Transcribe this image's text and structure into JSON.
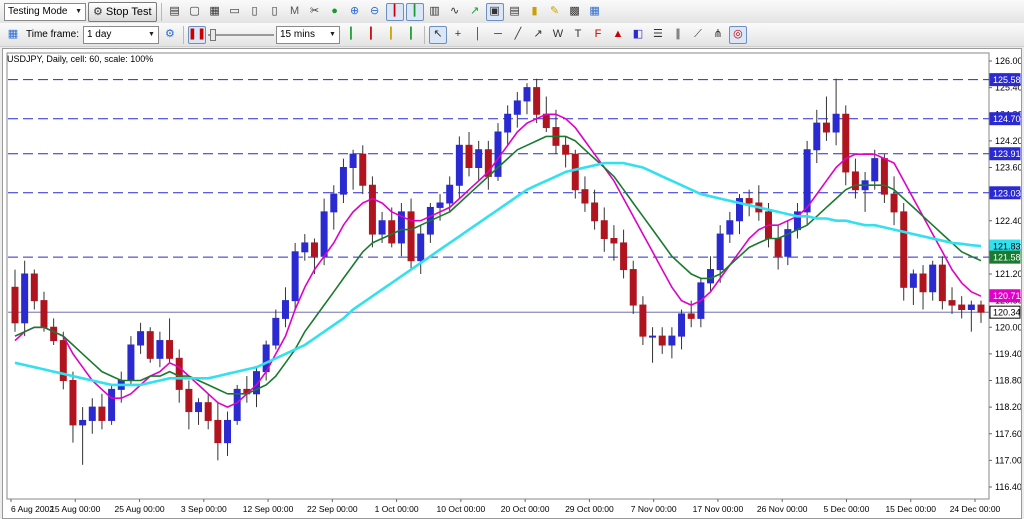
{
  "toolbar": {
    "mode_select": "Testing Mode",
    "stop_test_label": "Stop Test",
    "timeframe_label": "Time frame:",
    "timeframe_value": "1 day",
    "speed_value": "15 mins"
  },
  "icons_row1": [
    "bar-chart-icon",
    "window-icon",
    "tile-icon",
    "folder-icon",
    "new-doc-icon",
    "doc-icon",
    "document-m-icon",
    "scissors-icon",
    "record-icon",
    "zoom-in-icon",
    "zoom-out-icon",
    "candles-icon",
    "bars-icon",
    "layers-icon",
    "line-chart-icon",
    "chart-up-icon",
    "chart-box-icon",
    "template-icon",
    "book-icon",
    "brush-icon",
    "screenshot-icon",
    "calendar-icon"
  ],
  "icons_row2": [
    "cursor-icon",
    "crosshair-icon",
    "vertical-line-icon",
    "horizontal-line-icon",
    "trendline-icon",
    "ray-icon",
    "wave-w-icon",
    "text-t-icon",
    "fibo-icon",
    "arrow-icon",
    "color-icon",
    "horizontal-lines-icon",
    "channel-icon",
    "fan-icon",
    "pitchfork-icon",
    "magnet-icon"
  ],
  "chart_info": "USDJPY, Daily, cell: 60, scale: 100%",
  "colors": {
    "bull": "#2a2ad0",
    "bear": "#b0141e",
    "ma_fast": "#e000c8",
    "ma_mid": "#1a7a2e",
    "ma_slow": "#33e0ee",
    "level_line": "#2a2ad0"
  },
  "chart_data": {
    "type": "candlestick",
    "title": "USDJPY, Daily",
    "ylim": [
      116.4,
      126.0
    ],
    "y_ticks": [
      "126.00",
      "125.40",
      "124.80",
      "124.20",
      "123.60",
      "123.00",
      "122.40",
      "121.80",
      "121.20",
      "120.60",
      "120.00",
      "119.40",
      "118.80",
      "118.20",
      "117.60",
      "117.00",
      "116.40"
    ],
    "x_ticks": [
      "6 Aug 2002",
      "15 Aug 00:00",
      "25 Aug 00:00",
      "3 Sep 00:00",
      "12 Sep 00:00",
      "22 Sep 00:00",
      "1 Oct 00:00",
      "10 Oct 00:00",
      "20 Oct 00:00",
      "29 Oct 00:00",
      "7 Nov 00:00",
      "17 Nov 00:00",
      "26 Nov 00:00",
      "5 Dec 00:00",
      "15 Dec 00:00",
      "24 Dec 00:00"
    ],
    "levels": [
      {
        "value": 125.58,
        "label": "125.58"
      },
      {
        "value": 124.7,
        "label": "124.70"
      },
      {
        "value": 123.91,
        "label": "123.91"
      },
      {
        "value": 123.03,
        "label": "123.03"
      },
      {
        "value": 121.58,
        "label": "121.58"
      }
    ],
    "price_labels": [
      {
        "value": 121.83,
        "label": "121.83"
      },
      {
        "value": 121.58,
        "label": "121.58"
      },
      {
        "value": 120.71,
        "label": "120.71"
      },
      {
        "value": 120.34,
        "label": "120.34"
      }
    ],
    "current_price": 120.34,
    "candles": [
      [
        120.9,
        121.3,
        119.9,
        120.1
      ],
      [
        120.1,
        121.5,
        119.8,
        121.2
      ],
      [
        121.2,
        121.3,
        120.4,
        120.6
      ],
      [
        120.6,
        120.8,
        119.9,
        120.0
      ],
      [
        120.0,
        120.2,
        119.6,
        119.7
      ],
      [
        119.7,
        119.9,
        118.6,
        118.8
      ],
      [
        118.8,
        119.0,
        117.4,
        117.8
      ],
      [
        117.8,
        118.2,
        116.9,
        117.9
      ],
      [
        117.9,
        118.4,
        117.6,
        118.2
      ],
      [
        118.2,
        118.5,
        117.7,
        117.9
      ],
      [
        117.9,
        118.7,
        117.8,
        118.6
      ],
      [
        118.6,
        119.0,
        118.3,
        118.8
      ],
      [
        118.8,
        119.8,
        118.7,
        119.6
      ],
      [
        119.6,
        120.1,
        119.4,
        119.9
      ],
      [
        119.9,
        120.0,
        119.2,
        119.3
      ],
      [
        119.3,
        119.9,
        119.1,
        119.7
      ],
      [
        119.7,
        120.2,
        119.2,
        119.3
      ],
      [
        119.3,
        119.5,
        118.3,
        118.6
      ],
      [
        118.6,
        118.8,
        117.7,
        118.1
      ],
      [
        118.1,
        118.4,
        117.8,
        118.3
      ],
      [
        118.3,
        118.5,
        117.7,
        117.9
      ],
      [
        117.9,
        118.3,
        117.0,
        117.4
      ],
      [
        117.4,
        118.1,
        117.1,
        117.9
      ],
      [
        117.9,
        118.7,
        117.8,
        118.6
      ],
      [
        118.6,
        118.9,
        118.3,
        118.5
      ],
      [
        118.5,
        119.1,
        118.2,
        119.0
      ],
      [
        119.0,
        119.7,
        118.8,
        119.6
      ],
      [
        119.6,
        120.4,
        119.5,
        120.2
      ],
      [
        120.2,
        120.9,
        120.0,
        120.6
      ],
      [
        120.6,
        121.9,
        120.4,
        121.7
      ],
      [
        121.7,
        122.1,
        121.5,
        121.9
      ],
      [
        121.9,
        122.0,
        121.2,
        121.6
      ],
      [
        121.6,
        122.9,
        121.4,
        122.6
      ],
      [
        122.6,
        123.2,
        122.2,
        123.0
      ],
      [
        123.0,
        123.8,
        122.8,
        123.6
      ],
      [
        123.6,
        124.0,
        123.1,
        123.9
      ],
      [
        123.9,
        124.1,
        123.0,
        123.2
      ],
      [
        123.2,
        123.4,
        121.8,
        122.1
      ],
      [
        122.1,
        122.6,
        121.9,
        122.4
      ],
      [
        122.4,
        122.7,
        121.8,
        121.9
      ],
      [
        121.9,
        122.8,
        121.6,
        122.6
      ],
      [
        122.6,
        122.9,
        121.3,
        121.5
      ],
      [
        121.5,
        122.3,
        121.2,
        122.1
      ],
      [
        122.1,
        122.8,
        121.9,
        122.7
      ],
      [
        122.7,
        123.0,
        122.4,
        122.8
      ],
      [
        122.8,
        123.4,
        122.6,
        123.2
      ],
      [
        123.2,
        124.3,
        122.9,
        124.1
      ],
      [
        124.1,
        124.4,
        123.4,
        123.6
      ],
      [
        123.6,
        124.2,
        123.3,
        124.0
      ],
      [
        124.0,
        124.2,
        123.1,
        123.4
      ],
      [
        123.4,
        124.6,
        123.3,
        124.4
      ],
      [
        124.4,
        125.0,
        124.1,
        124.8
      ],
      [
        124.8,
        125.3,
        124.5,
        125.1
      ],
      [
        125.1,
        125.5,
        124.8,
        125.4
      ],
      [
        125.4,
        125.6,
        124.6,
        124.8
      ],
      [
        124.8,
        125.2,
        124.4,
        124.5
      ],
      [
        124.5,
        124.9,
        123.9,
        124.1
      ],
      [
        124.1,
        124.3,
        123.6,
        123.9
      ],
      [
        123.9,
        124.0,
        122.9,
        123.1
      ],
      [
        123.1,
        123.4,
        122.6,
        122.8
      ],
      [
        122.8,
        123.1,
        122.2,
        122.4
      ],
      [
        122.4,
        122.7,
        121.7,
        122.0
      ],
      [
        122.0,
        122.3,
        121.5,
        121.9
      ],
      [
        121.9,
        122.2,
        121.1,
        121.3
      ],
      [
        121.3,
        121.5,
        120.3,
        120.5
      ],
      [
        120.5,
        120.7,
        119.6,
        119.8
      ],
      [
        119.8,
        120.0,
        119.2,
        119.8
      ],
      [
        119.8,
        120.0,
        119.4,
        119.6
      ],
      [
        119.6,
        120.0,
        119.3,
        119.8
      ],
      [
        119.8,
        120.4,
        119.5,
        120.3
      ],
      [
        120.3,
        120.6,
        120.0,
        120.2
      ],
      [
        120.2,
        121.1,
        120.0,
        121.0
      ],
      [
        121.0,
        121.6,
        120.8,
        121.3
      ],
      [
        121.3,
        122.3,
        121.0,
        122.1
      ],
      [
        122.1,
        122.6,
        121.9,
        122.4
      ],
      [
        122.4,
        123.0,
        122.1,
        122.9
      ],
      [
        122.9,
        123.1,
        122.5,
        122.8
      ],
      [
        122.8,
        123.2,
        122.4,
        122.6
      ],
      [
        122.6,
        122.8,
        121.8,
        122.0
      ],
      [
        122.0,
        122.3,
        121.3,
        121.6
      ],
      [
        121.6,
        122.4,
        121.4,
        122.2
      ],
      [
        122.2,
        122.8,
        122.0,
        122.6
      ],
      [
        122.6,
        124.2,
        122.3,
        124.0
      ],
      [
        124.0,
        124.9,
        123.7,
        124.6
      ],
      [
        124.6,
        125.2,
        124.2,
        124.4
      ],
      [
        124.4,
        125.6,
        124.1,
        124.8
      ],
      [
        124.8,
        125.0,
        123.2,
        123.5
      ],
      [
        123.5,
        123.8,
        122.9,
        123.1
      ],
      [
        123.1,
        123.5,
        122.6,
        123.3
      ],
      [
        123.3,
        124.0,
        123.1,
        123.8
      ],
      [
        123.8,
        123.9,
        122.8,
        123.0
      ],
      [
        123.0,
        123.4,
        122.3,
        122.6
      ],
      [
        122.6,
        122.8,
        120.6,
        120.9
      ],
      [
        120.9,
        121.3,
        120.5,
        121.2
      ],
      [
        121.2,
        121.4,
        120.4,
        120.8
      ],
      [
        120.8,
        121.5,
        120.6,
        121.4
      ],
      [
        121.4,
        121.6,
        120.4,
        120.6
      ],
      [
        120.6,
        120.9,
        120.3,
        120.5
      ],
      [
        120.5,
        120.7,
        120.2,
        120.4
      ],
      [
        120.4,
        120.6,
        119.9,
        120.5
      ],
      [
        120.5,
        120.6,
        120.1,
        120.34
      ]
    ],
    "series": [
      {
        "role": "ma_fast",
        "values": [
          119.7,
          119.9,
          120.0,
          120.0,
          119.9,
          119.8,
          119.4,
          119.1,
          118.8,
          118.6,
          118.4,
          118.4,
          118.5,
          118.7,
          118.9,
          119.0,
          119.2,
          119.1,
          118.9,
          118.7,
          118.5,
          118.3,
          118.2,
          118.3,
          118.5,
          118.7,
          119.0,
          119.4,
          119.8,
          120.4,
          120.9,
          121.3,
          121.6,
          121.9,
          122.3,
          122.6,
          122.8,
          122.9,
          122.8,
          122.6,
          122.5,
          122.4,
          122.4,
          122.5,
          122.6,
          122.7,
          122.9,
          123.1,
          123.3,
          123.5,
          123.8,
          124.1,
          124.4,
          124.6,
          124.7,
          124.8,
          124.8,
          124.7,
          124.5,
          124.2,
          123.9,
          123.6,
          123.3,
          122.9,
          122.5,
          122.1,
          121.7,
          121.3,
          120.9,
          120.6,
          120.5,
          120.6,
          120.8,
          121.1,
          121.4,
          121.7,
          122.0,
          122.2,
          122.3,
          122.3,
          122.4,
          122.5,
          122.7,
          123.0,
          123.3,
          123.6,
          123.8,
          123.9,
          123.9,
          123.9,
          123.8,
          123.7,
          123.3,
          122.9,
          122.5,
          122.1,
          121.7,
          121.3,
          121.0,
          120.8,
          120.7
        ]
      },
      {
        "role": "ma_mid",
        "values": [
          119.8,
          119.9,
          120.0,
          120.0,
          119.9,
          119.8,
          119.6,
          119.4,
          119.2,
          119.0,
          118.9,
          118.8,
          118.8,
          118.8,
          118.9,
          118.9,
          119.0,
          118.9,
          118.9,
          118.8,
          118.7,
          118.6,
          118.5,
          118.5,
          118.5,
          118.6,
          118.7,
          118.9,
          119.2,
          119.5,
          119.9,
          120.2,
          120.5,
          120.8,
          121.1,
          121.4,
          121.7,
          121.9,
          122.0,
          122.1,
          122.2,
          122.2,
          122.3,
          122.4,
          122.5,
          122.6,
          122.8,
          123.0,
          123.2,
          123.4,
          123.6,
          123.8,
          124.0,
          124.1,
          124.2,
          124.3,
          124.3,
          124.3,
          124.2,
          124.0,
          123.8,
          123.6,
          123.4,
          123.1,
          122.8,
          122.5,
          122.2,
          121.9,
          121.6,
          121.4,
          121.2,
          121.1,
          121.1,
          121.2,
          121.4,
          121.6,
          121.8,
          121.9,
          122.0,
          122.0,
          122.1,
          122.2,
          122.3,
          122.5,
          122.7,
          122.9,
          123.1,
          123.2,
          123.2,
          123.2,
          123.2,
          123.1,
          122.9,
          122.7,
          122.5,
          122.3,
          122.1,
          121.9,
          121.7,
          121.6,
          121.5
        ]
      },
      {
        "role": "ma_slow",
        "values": [
          119.2,
          119.15,
          119.1,
          119.05,
          119.0,
          118.95,
          118.9,
          118.85,
          118.8,
          118.75,
          118.7,
          118.7,
          118.7,
          118.7,
          118.75,
          118.8,
          118.85,
          118.85,
          118.85,
          118.85,
          118.85,
          118.9,
          118.95,
          119.0,
          119.05,
          119.1,
          119.2,
          119.3,
          119.4,
          119.5,
          119.6,
          119.75,
          119.9,
          120.05,
          120.2,
          120.4,
          120.55,
          120.7,
          120.85,
          121.0,
          121.15,
          121.3,
          121.45,
          121.6,
          121.75,
          121.9,
          122.05,
          122.2,
          122.35,
          122.5,
          122.65,
          122.8,
          122.95,
          123.1,
          123.2,
          123.3,
          123.4,
          123.5,
          123.55,
          123.6,
          123.65,
          123.7,
          123.7,
          123.7,
          123.65,
          123.6,
          123.5,
          123.4,
          123.3,
          123.2,
          123.1,
          123.0,
          122.95,
          122.9,
          122.85,
          122.8,
          122.75,
          122.7,
          122.65,
          122.6,
          122.55,
          122.5,
          122.5,
          122.45,
          122.45,
          122.4,
          122.4,
          122.35,
          122.3,
          122.3,
          122.25,
          122.2,
          122.15,
          122.1,
          122.05,
          122.0,
          121.95,
          121.9,
          121.88,
          121.85,
          121.83
        ]
      }
    ]
  }
}
